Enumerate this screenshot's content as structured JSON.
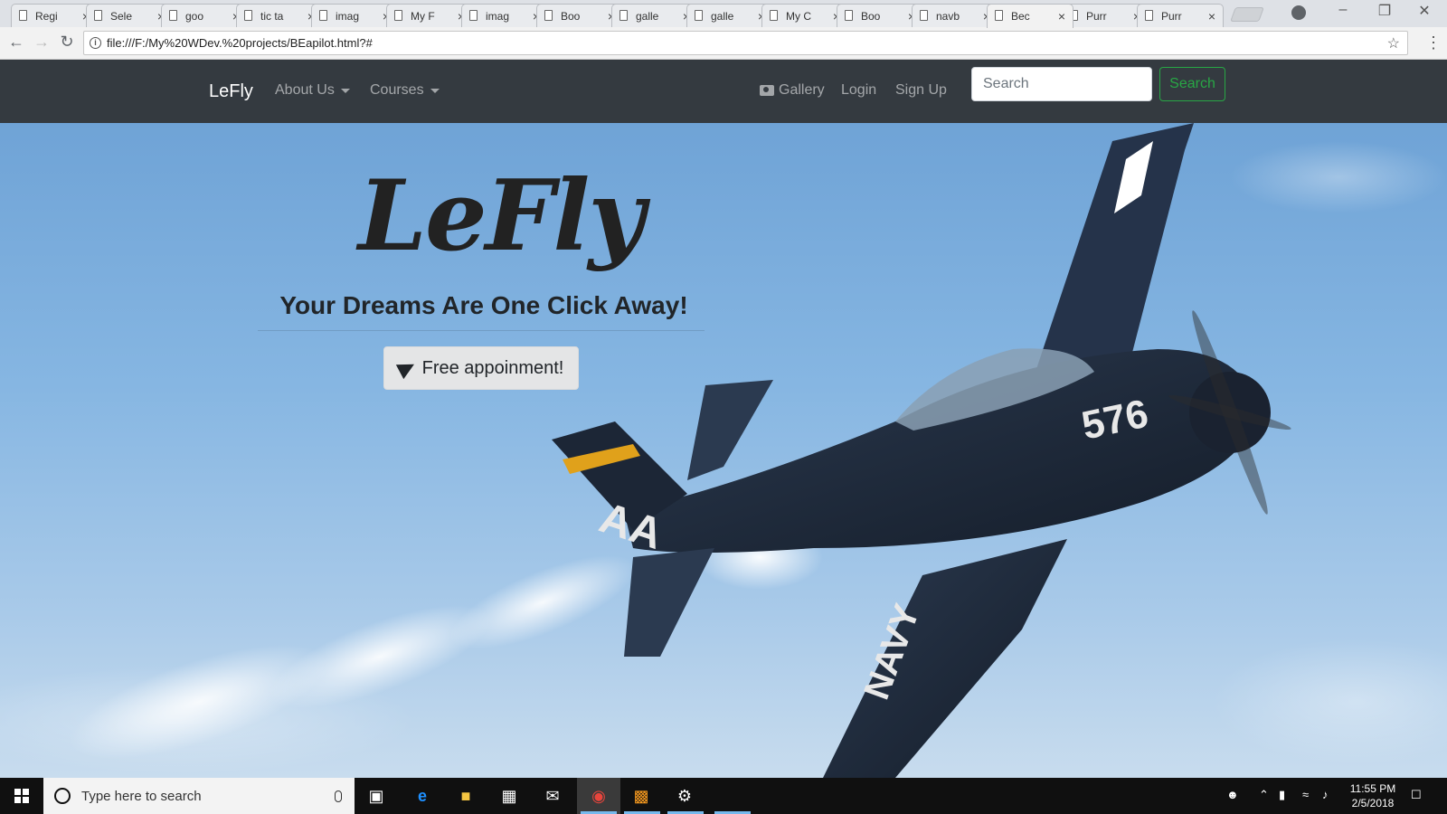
{
  "browser": {
    "tabs": [
      {
        "title": "Regi"
      },
      {
        "title": "Sele"
      },
      {
        "title": "goo"
      },
      {
        "title": "tic ta"
      },
      {
        "title": "imag"
      },
      {
        "title": "My F"
      },
      {
        "title": "imag"
      },
      {
        "title": "Boo"
      },
      {
        "title": "galle"
      },
      {
        "title": "galle"
      },
      {
        "title": "My C"
      },
      {
        "title": "Boo"
      },
      {
        "title": "navb"
      },
      {
        "title": "Bec",
        "active": true
      },
      {
        "title": "Purr"
      },
      {
        "title": "Purr"
      }
    ],
    "url": "file:///F:/My%20WDev.%20projects/BEapilot.html?#",
    "icons": {
      "back": "back-arrow-icon",
      "forward": "forward-arrow-icon",
      "reload": "reload-icon",
      "info": "info-icon",
      "star": "bookmark-star-icon"
    }
  },
  "navbar": {
    "brand": "LeFly",
    "about": "About Us",
    "courses": "Courses",
    "gallery": "Gallery",
    "login": "Login",
    "signup": "Sign Up",
    "search_placeholder": "Search",
    "search_button": "Search",
    "colors": {
      "bg": "#343a40",
      "search_outline": "#28a745"
    }
  },
  "hero": {
    "logo": "LeFly",
    "tagline": "Your Dreams Are One Click Away!",
    "cta": "Free appoinment!"
  },
  "taskbar": {
    "search_placeholder": "Type here to search",
    "time": "11:55 PM",
    "date": "2/5/2018"
  }
}
